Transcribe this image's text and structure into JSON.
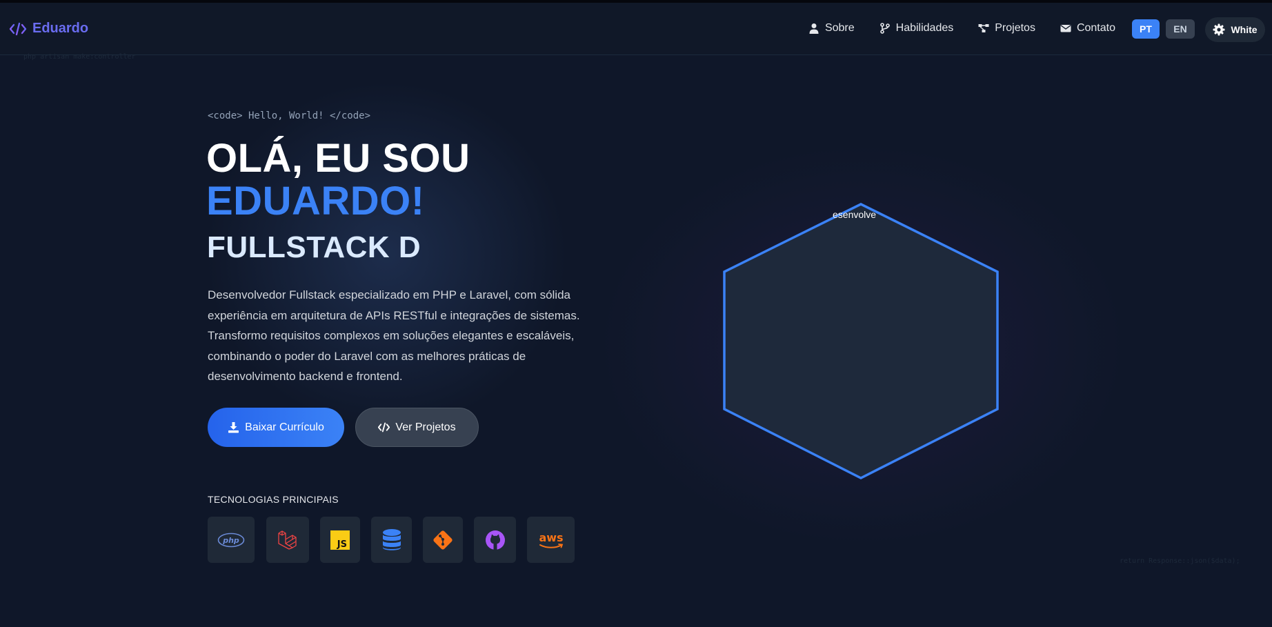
{
  "nav": {
    "brand": "Eduardo",
    "items": [
      {
        "label": "Sobre",
        "icon": "user-icon"
      },
      {
        "label": "Habilidades",
        "icon": "git-branch-icon"
      },
      {
        "label": "Projetos",
        "icon": "project-diagram-icon"
      },
      {
        "label": "Contato",
        "icon": "envelope-icon"
      }
    ],
    "lang": {
      "pt": "PT",
      "en": "EN",
      "active": "PT"
    },
    "theme_label": "White"
  },
  "background_code": {
    "top_left": "php artisan make:controller",
    "bottom_right": "return Response::json($data);"
  },
  "hero": {
    "code_tag": "<code> Hello, World! </code>",
    "line1": "OLÁ, EU SOU",
    "name": "EDUARDO!",
    "typed_role": "FULLSTACK D",
    "description": "Desenvolvedor Fullstack especializado em PHP e Laravel, com sólida experiência em arquitetura de APIs RESTful e integrações de sistemas. Transformo requisitos complexos em soluções elegantes e escaláveis, combinando o poder do Laravel com as melhores práticas de desenvolvimento backend e frontend.",
    "btn_download": "Baixar Currículo",
    "btn_projects": "Ver Projetos"
  },
  "tech": {
    "title": "TECNOLOGIAS PRINCIPAIS",
    "items": [
      "php-icon",
      "laravel-icon",
      "javascript-icon",
      "database-icon",
      "git-icon",
      "github-icon",
      "aws-icon"
    ]
  },
  "hexagon": {
    "label": "esenvolve"
  },
  "colors": {
    "background": "#0f1729",
    "accent": "#3b82f6",
    "brand": "#6a6cf0"
  }
}
